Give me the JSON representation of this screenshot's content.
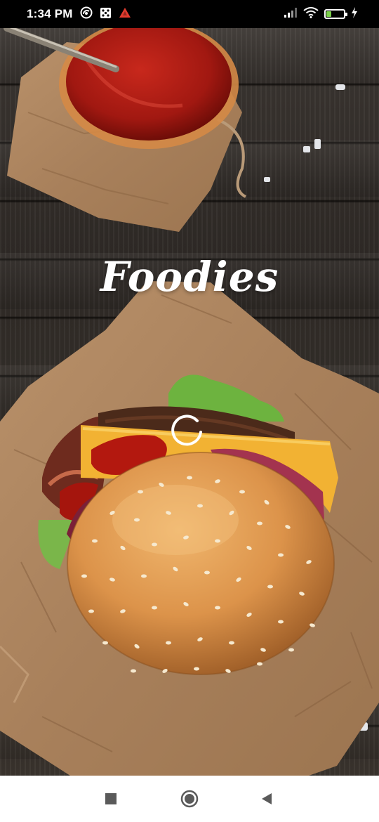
{
  "status_bar": {
    "time": "1:34 PM",
    "left_icons": [
      "vpn-icon",
      "dice-icon",
      "app-alert-icon"
    ],
    "right_icons": [
      "signal-icon",
      "wifi-icon",
      "battery-icon",
      "charging-icon"
    ],
    "battery_level": "29",
    "battery_color": "#7bd14a"
  },
  "splash": {
    "app_name": "Foodies",
    "loading": true
  },
  "nav_bar": {
    "buttons": [
      "recents-button",
      "home-button",
      "back-button"
    ]
  }
}
